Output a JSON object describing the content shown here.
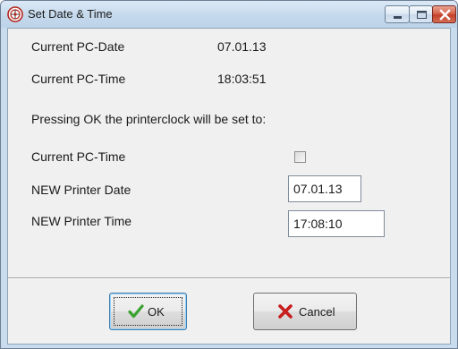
{
  "window": {
    "title": "Set Date & Time"
  },
  "info": {
    "pc_date_label": "Current PC-Date",
    "pc_date_value": "07.01.13",
    "pc_time_label": "Current PC-Time",
    "pc_time_value": "18:03:51",
    "message": "Pressing OK the printerclock will be set to:"
  },
  "form": {
    "use_pc_time_label": "Current PC-Time",
    "use_pc_time_checked": false,
    "printer_date_label": "NEW Printer Date",
    "printer_date_value": "07.01.13",
    "printer_time_label": "NEW Printer Time",
    "printer_time_value": "17:08:10"
  },
  "buttons": {
    "ok_label": "OK",
    "cancel_label": "Cancel"
  },
  "icons": {
    "app": "target-app-icon",
    "ok": "green-checkmark-icon",
    "cancel": "red-x-icon"
  },
  "colors": {
    "ok_check": "#3aa12f",
    "cancel_x": "#c81e1e",
    "close_button": "#c9452e"
  }
}
